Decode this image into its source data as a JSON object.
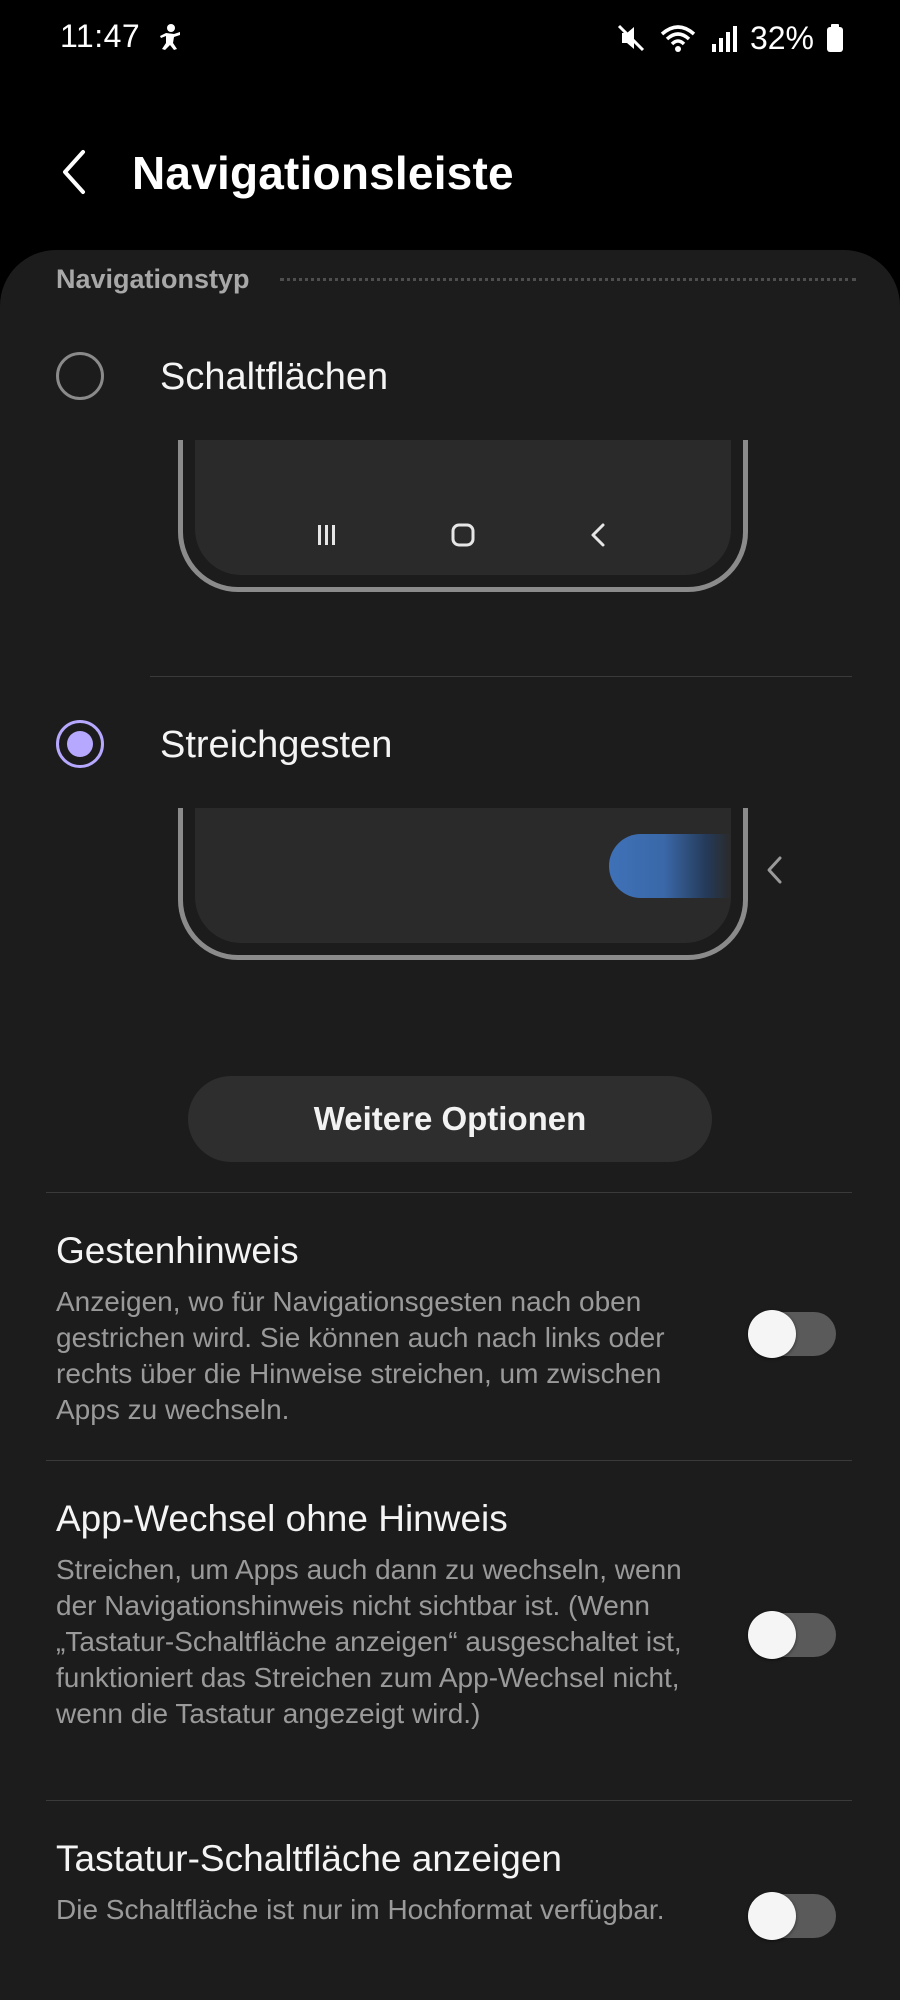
{
  "status_bar": {
    "time": "11:47",
    "battery_percent": "32%",
    "icons": [
      "accessibility-notification-icon",
      "mute-icon",
      "wifi-icon",
      "signal-icon",
      "battery-icon"
    ]
  },
  "app_bar": {
    "title": "Navigationsleiste",
    "back_icon": "chevron-left-icon"
  },
  "navigation_type": {
    "header": "Navigationstyp",
    "options": [
      {
        "label": "Schaltflächen",
        "selected": false,
        "preview_icons": [
          "recents-icon",
          "home-icon",
          "back-icon"
        ]
      },
      {
        "label": "Streichgesten",
        "selected": true,
        "preview_icons": [
          "gesture-handle",
          "chevron-left-icon"
        ]
      }
    ],
    "accent_color": "#b6a8ff",
    "more_options_label": "Weitere Optionen"
  },
  "settings": [
    {
      "title": "Gestenhinweis",
      "description": "Anzeigen, wo für Navigationsgesten nach oben gestrichen wird. Sie können auch nach links oder rechts über die Hinweise streichen, um zwischen Apps zu wechseln.",
      "enabled": false
    },
    {
      "title": "App-Wechsel ohne Hinweis",
      "description": "Streichen, um Apps auch dann zu wechseln, wenn der Navigationshinweis nicht sichtbar ist. (Wenn „Tastatur-Schaltfläche anzeigen“ ausgeschaltet ist, funktioniert das Streichen zum App-Wechsel nicht, wenn die Tastatur angezeigt wird.)",
      "enabled": false
    },
    {
      "title": "Tastatur-Schaltfläche anzeigen",
      "description": "Die Schaltfläche ist nur im Hochformat verfügbar.",
      "enabled": false
    }
  ]
}
